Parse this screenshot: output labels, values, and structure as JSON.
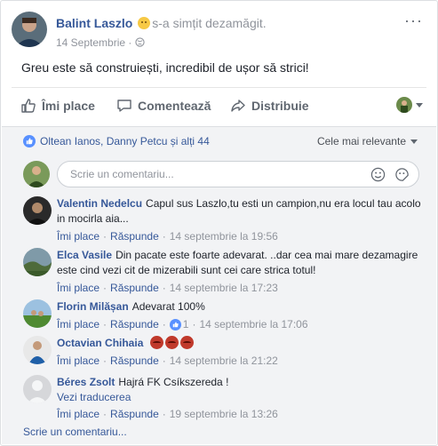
{
  "post": {
    "author": "Balint Laszlo",
    "feeling_text": "s-a simțit dezamăgit.",
    "date": "14 Septembrie",
    "date_separator": "·",
    "more_menu": "···",
    "text": "Greu este să construiești, incredibil de ușor să strici!"
  },
  "actions": {
    "like": "Îmi place",
    "comment": "Comentează",
    "share": "Distribuie"
  },
  "reactions": {
    "summary": "Oltean Ianos, Danny Petcu și alți 44",
    "sort": "Cele mai relevante"
  },
  "composer": {
    "placeholder": "Scrie un comentariu..."
  },
  "comment_actions": {
    "like": "Îmi place",
    "reply": "Răspunde",
    "dot": "·"
  },
  "comments": [
    {
      "name": "Valentin Nedelcu",
      "text": "Capul sus Laszlo,tu esti un campion,nu era locul tau acolo in mocirla aia...",
      "time": "14 septembrie la 19:56"
    },
    {
      "name": "Elca Vasile",
      "text": "Din pacate este foarte adevarat. ..dar cea mai mare dezamagire este cind vezi cit de mizerabili sunt cei care strica totul!",
      "time": "14 septembrie la 17:23"
    },
    {
      "name": "Florin Milășan",
      "text": "Adevarat 100%",
      "reaction_count": "1",
      "time": "14 septembrie la 17:06"
    },
    {
      "name": "Octavian Chihaia",
      "text": "",
      "emoji": "angry-devil-emoji",
      "time": "14 septembrie la 21:22"
    },
    {
      "name": "Béres Zsolt",
      "text": "Hajrá FK Csíkszereda !",
      "translate": "Vezi traducerea",
      "time": "19 septembrie la 13:26"
    }
  ],
  "footer": {
    "write_comment": "Scrie un comentariu..."
  },
  "colors": {
    "link": "#365899",
    "muted": "#90949c",
    "like_blue": "#5890ff",
    "background_gray": "#f2f3f5"
  }
}
